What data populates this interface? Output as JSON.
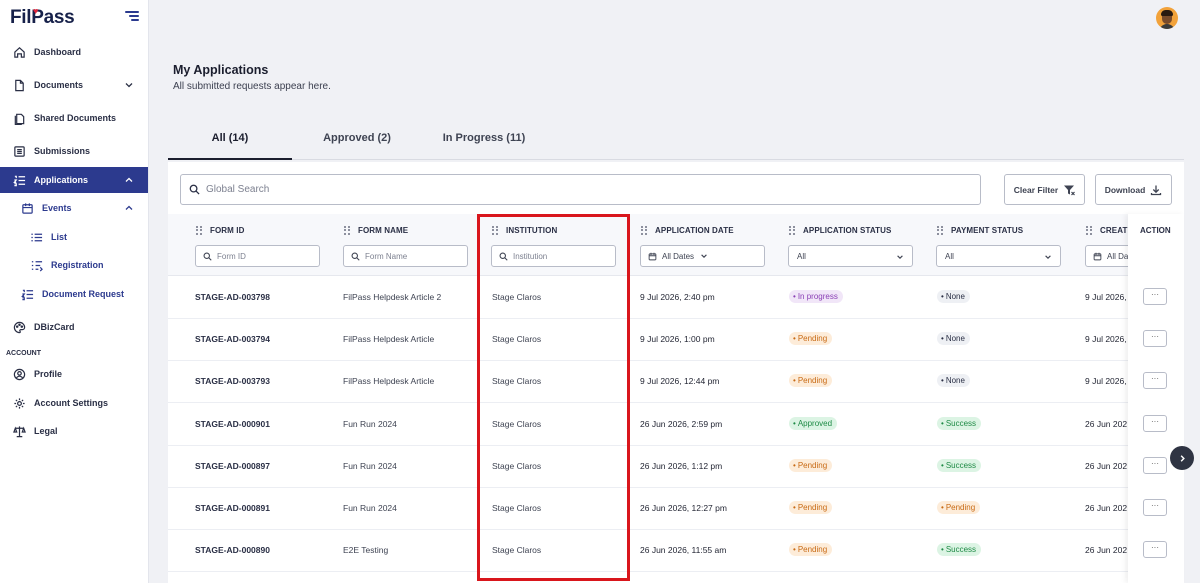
{
  "app": {
    "logo": "FilPass"
  },
  "sidebar": {
    "items": [
      {
        "label": "Dashboard",
        "icon": "home-icon"
      },
      {
        "label": "Documents",
        "icon": "document-icon"
      },
      {
        "label": "Shared Documents",
        "icon": "shared-documents-icon"
      },
      {
        "label": "Submissions",
        "icon": "submissions-icon"
      },
      {
        "label": "Applications",
        "icon": "applications-icon"
      },
      {
        "label": "Events",
        "icon": "calendar-icon"
      },
      {
        "label": "List",
        "icon": "list-icon"
      },
      {
        "label": "Registration",
        "icon": "registration-icon"
      },
      {
        "label": "Document Request",
        "icon": "document-request-icon"
      },
      {
        "label": "DBizCard",
        "icon": "palette-icon"
      },
      {
        "label": "Profile",
        "icon": "user-icon"
      },
      {
        "label": "Account Settings",
        "icon": "gear-icon"
      },
      {
        "label": "Legal",
        "icon": "scale-icon"
      }
    ],
    "section_label": "ACCOUNT"
  },
  "header": {
    "title": "My Applications",
    "subtitle": "All submitted requests appear here."
  },
  "tabs": [
    {
      "label": "All (14)",
      "active": true
    },
    {
      "label": "Approved (2)",
      "active": false
    },
    {
      "label": "In Progress (11)",
      "active": false
    }
  ],
  "toolbar": {
    "search_placeholder": "Global Search",
    "clear_filter": "Clear Filter",
    "download": "Download"
  },
  "table": {
    "columns": [
      "FORM ID",
      "FORM NAME",
      "INSTITUTION",
      "APPLICATION DATE",
      "APPLICATION STATUS",
      "PAYMENT STATUS",
      "CREATE",
      "ACTION"
    ],
    "filters": {
      "form_id": "Form ID",
      "form_name": "Form Name",
      "institution": "Institution",
      "application_date": "All Dates",
      "application_status": "All",
      "payment_status": "All",
      "created": "All Da"
    },
    "rows": [
      {
        "form_id": "STAGE-AD-003798",
        "form_name": "FilPass Helpdesk Article 2",
        "institution": "Stage Claros",
        "date": "9 Jul 2026, 2:40 pm",
        "app_status": "In progress",
        "pay_status": "None",
        "created": "9 Jul 2026,",
        "action": "···"
      },
      {
        "form_id": "STAGE-AD-003794",
        "form_name": "FilPass Helpdesk Article",
        "institution": "Stage Claros",
        "date": "9 Jul 2026, 1:00 pm",
        "app_status": "Pending",
        "pay_status": "None",
        "created": "9 Jul 2026,",
        "action": "···"
      },
      {
        "form_id": "STAGE-AD-003793",
        "form_name": "FilPass Helpdesk Article",
        "institution": "Stage Claros",
        "date": "9 Jul 2026, 12:44 pm",
        "app_status": "Pending",
        "pay_status": "None",
        "created": "9 Jul 2026,",
        "action": "···"
      },
      {
        "form_id": "STAGE-AD-000901",
        "form_name": "Fun Run 2024",
        "institution": "Stage Claros",
        "date": "26 Jun 2026, 2:59 pm",
        "app_status": "Approved",
        "pay_status": "Success",
        "created": "26 Jun 202",
        "action": "···"
      },
      {
        "form_id": "STAGE-AD-000897",
        "form_name": "Fun Run 2024",
        "institution": "Stage Claros",
        "date": "26 Jun 2026, 1:12 pm",
        "app_status": "Pending",
        "pay_status": "Success",
        "created": "26 Jun 202",
        "action": "···"
      },
      {
        "form_id": "STAGE-AD-000891",
        "form_name": "Fun Run 2024",
        "institution": "Stage Claros",
        "date": "26 Jun 2026, 12:27 pm",
        "app_status": "Pending",
        "pay_status": "Pending",
        "created": "26 Jun 202",
        "action": "···"
      },
      {
        "form_id": "STAGE-AD-000890",
        "form_name": "E2E Testing",
        "institution": "Stage Claros",
        "date": "26 Jun 2026, 11:55 am",
        "app_status": "Pending",
        "pay_status": "Success",
        "created": "26 Jun 202",
        "action": "···"
      }
    ]
  },
  "colors": {
    "primary": "#2c3a8e",
    "highlight": "#d9161c"
  }
}
